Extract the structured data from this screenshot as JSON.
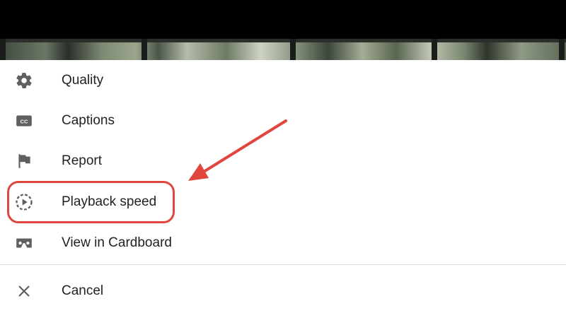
{
  "menu": {
    "items": [
      {
        "label": "Quality",
        "icon": "gear-icon"
      },
      {
        "label": "Captions",
        "icon": "cc-icon"
      },
      {
        "label": "Report",
        "icon": "flag-icon"
      },
      {
        "label": "Playback speed",
        "icon": "playback-speed-icon"
      },
      {
        "label": "View in Cardboard",
        "icon": "cardboard-icon"
      }
    ],
    "cancel": {
      "label": "Cancel",
      "icon": "close-icon"
    }
  },
  "annotation": {
    "highlight_color": "#e0463d",
    "highlighted_item": "Playback speed"
  },
  "colors": {
    "icon": "#5f5f5f",
    "text": "#222222",
    "divider": "#e0e0e0"
  }
}
